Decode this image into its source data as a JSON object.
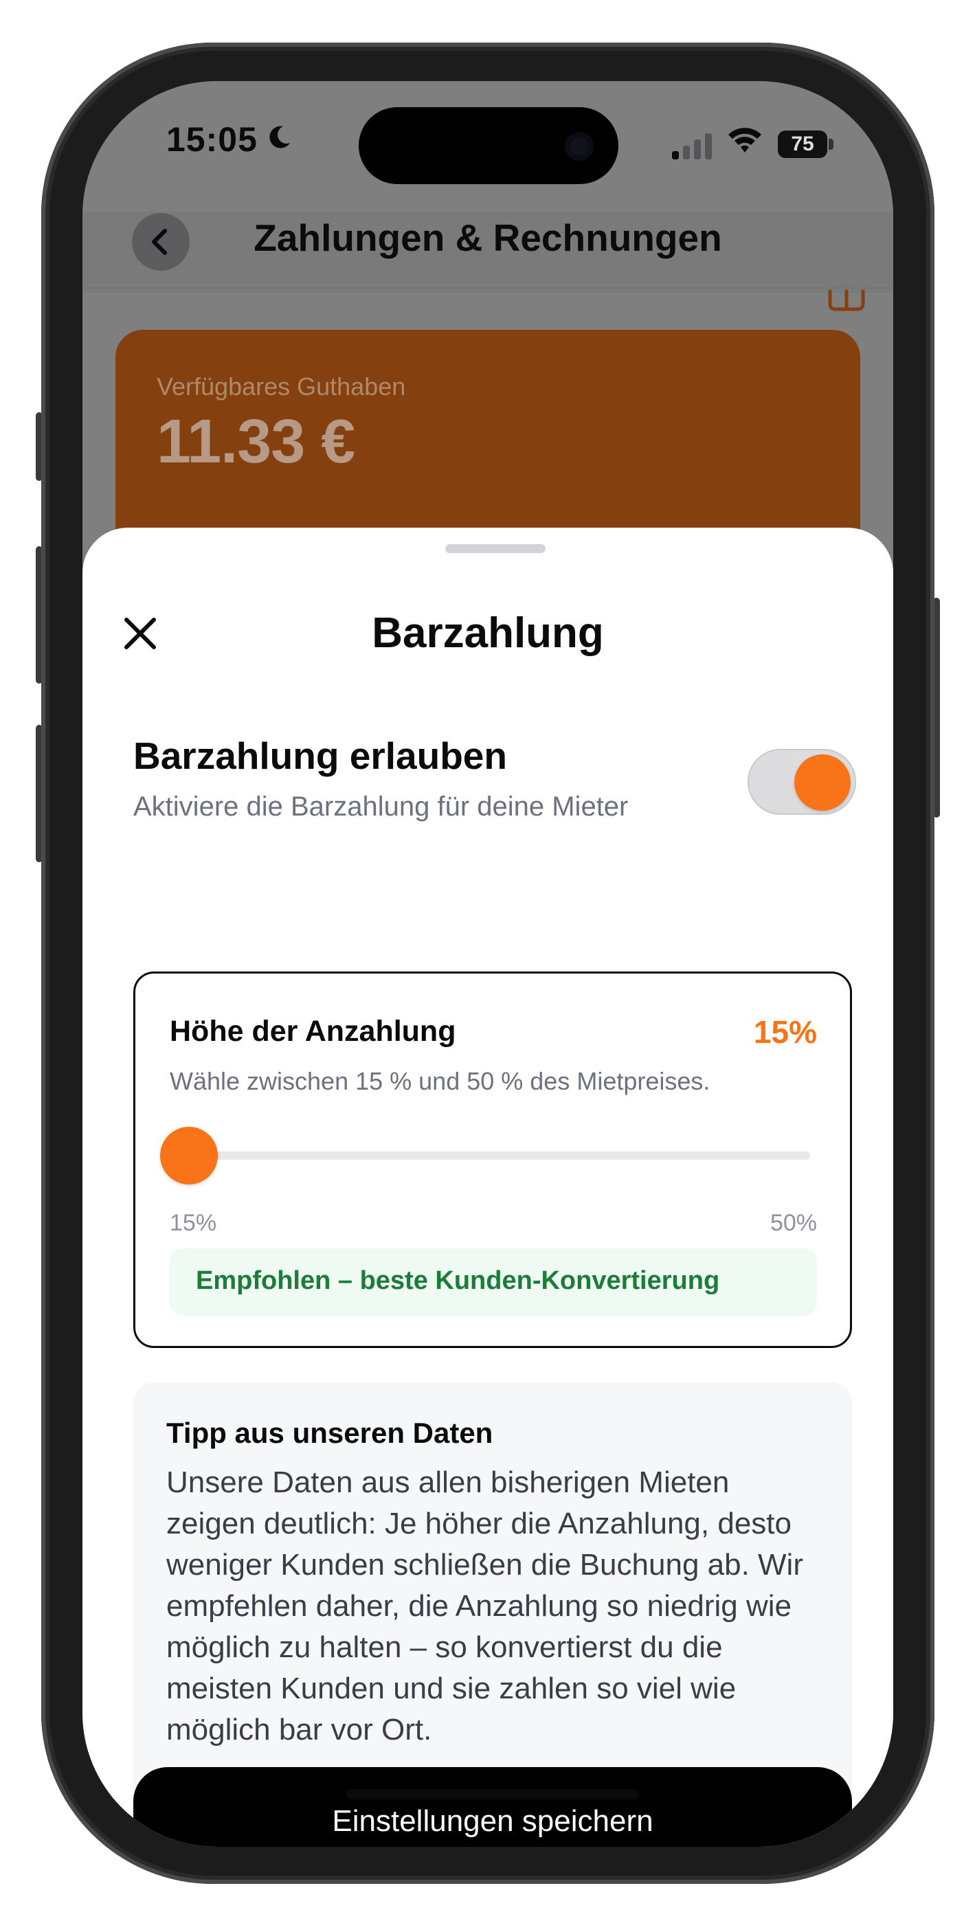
{
  "status_bar": {
    "time": "15:05",
    "battery": "75",
    "icons": [
      "moon-icon",
      "signal-icon",
      "wifi-icon",
      "battery-icon"
    ]
  },
  "background_screen": {
    "header_title": "Zahlungen & Rechnungen",
    "back_icon": "chevron-left-icon",
    "balance_label": "Verfügbares Guthaben",
    "balance_value": "11.33 €"
  },
  "sheet": {
    "title": "Barzahlung",
    "close_icon": "close-icon",
    "toggle": {
      "title": "Barzahlung erlauben",
      "subtitle": "Aktiviere die Barzahlung für deine Mieter",
      "enabled": true
    },
    "deposit": {
      "title": "Höhe der Anzahlung",
      "value_label": "15%",
      "subtitle": "Wähle zwischen 15 % und 50 % des Mietpreises.",
      "slider_value": 15,
      "slider_min": 15,
      "slider_max": 50,
      "min_label": "15%",
      "max_label": "50%",
      "recommendation": "Empfohlen – beste Kunden-Konvertierung"
    },
    "tip": {
      "title": "Tipp aus unseren Daten",
      "body": "Unsere Daten aus allen bisherigen Mieten zeigen deutlich: Je höher die Anzahlung, desto weniger Kunden schließen die Buchung ab. Wir empfehlen daher, die Anzahlung so niedrig wie möglich zu halten – so konvertierst du die meisten Kunden und sie zahlen so viel wie möglich bar vor Ort."
    },
    "save_button": "Einstellungen speichern"
  },
  "colors": {
    "accent": "#f97318",
    "balance_card": "#84400e",
    "recommendation_bg": "#effaf2",
    "recommendation_text": "#1c7d3a",
    "overlay": "#7f7f80"
  }
}
